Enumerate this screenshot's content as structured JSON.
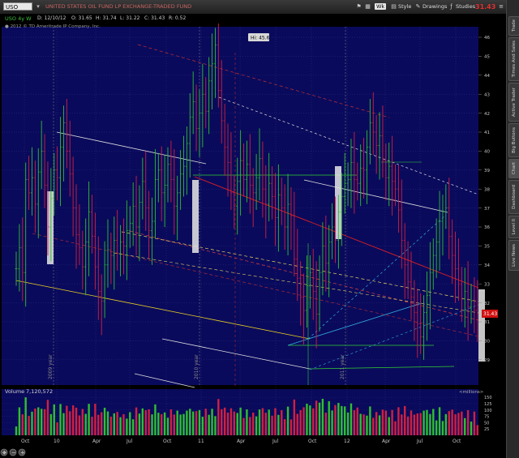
{
  "toolbar": {
    "symbol": "USO",
    "company": "UNITED STATES OIL FUND LP EXCHANGE-TRADED FUND",
    "aggregation": "Wk",
    "style_label": "Style",
    "drawings_label": "Drawings",
    "studies_label": "Studies",
    "last_price": "31.43"
  },
  "quote": {
    "label": "USO 4y W",
    "date": "D: 12/10/12",
    "open": "O: 31.65",
    "high": "H: 31.74",
    "low": "L: 31.22",
    "close": "C: 31.43",
    "change": "R: 0.52",
    "copyright": "2012 © TD Ameritrade IP Company, Inc."
  },
  "sidebar": {
    "tabs": [
      "Trade",
      "Times And Sales",
      "Active Trader",
      "Big Buttons",
      "Chart",
      "Dashboard",
      "Level II",
      "Live News"
    ]
  },
  "colors": {
    "background": "#0a0a5c",
    "grid": "#3a3a8a",
    "up": "#2fbf2f",
    "down": "#d02040",
    "price_tag": "#d01010"
  },
  "chart_data": {
    "type": "bar",
    "period": "weekly",
    "y_range": [
      28,
      47
    ],
    "y_ticks": [
      "46",
      "45",
      "44",
      "43",
      "42",
      "41",
      "40",
      "39",
      "38",
      "37",
      "36",
      "35",
      "34",
      "33",
      "32",
      "31",
      "30",
      "29"
    ],
    "hi_label": "Hi: 45.6",
    "x_labels": [
      "Oct",
      "10",
      "Apr",
      "Jul",
      "Oct",
      "11",
      "Apr",
      "Jul",
      "Oct",
      "12",
      "Apr",
      "Jul",
      "Oct"
    ],
    "year_labels": [
      "2009 year",
      "2010 year",
      "2011 year"
    ],
    "last_price": "31.43",
    "volume": {
      "label": "Volume",
      "value": "7,120,572",
      "unit": "<millions>",
      "ticks": [
        "150",
        "125",
        "100",
        "75",
        "50",
        "25"
      ],
      "y_range": [
        0,
        160
      ]
    },
    "price_series": [
      {
        "t": 0,
        "close": 33.8
      },
      {
        "t": 4,
        "close": 34.9
      },
      {
        "t": 8,
        "close": 33.6
      },
      {
        "t": 12,
        "close": 38.5
      },
      {
        "t": 16,
        "close": 37.8
      },
      {
        "t": 20,
        "close": 38.6
      },
      {
        "t": 24,
        "close": 37.2
      },
      {
        "t": 28,
        "close": 38.9
      },
      {
        "t": 32,
        "close": 40.0
      },
      {
        "t": 36,
        "close": 38.2
      },
      {
        "t": 40,
        "close": 36.0
      },
      {
        "t": 44,
        "close": 37.5
      },
      {
        "t": 48,
        "close": 39.0
      },
      {
        "t": 52,
        "close": 38.6
      },
      {
        "t": 56,
        "close": 40.2
      },
      {
        "t": 60,
        "close": 41.5
      },
      {
        "t": 64,
        "close": 40.0
      },
      {
        "t": 68,
        "close": 38.8
      },
      {
        "t": 72,
        "close": 37.0
      },
      {
        "t": 76,
        "close": 35.6
      },
      {
        "t": 80,
        "close": 34.9
      },
      {
        "t": 84,
        "close": 33.9
      },
      {
        "t": 88,
        "close": 35.2
      },
      {
        "t": 92,
        "close": 36.8
      },
      {
        "t": 96,
        "close": 35.5
      },
      {
        "t": 100,
        "close": 33.9
      },
      {
        "t": 104,
        "close": 32.6
      },
      {
        "t": 108,
        "close": 32.1
      },
      {
        "t": 112,
        "close": 34.0
      },
      {
        "t": 116,
        "close": 34.8
      },
      {
        "t": 120,
        "close": 34.5
      },
      {
        "t": 124,
        "close": 35.3
      },
      {
        "t": 128,
        "close": 34.6
      },
      {
        "t": 132,
        "close": 35.2
      },
      {
        "t": 136,
        "close": 35.0
      },
      {
        "t": 140,
        "close": 35.8
      },
      {
        "t": 144,
        "close": 36.2
      },
      {
        "t": 148,
        "close": 37.1
      },
      {
        "t": 152,
        "close": 36.0
      },
      {
        "t": 156,
        "close": 37.3
      },
      {
        "t": 160,
        "close": 38.4
      },
      {
        "t": 164,
        "close": 37.0
      },
      {
        "t": 168,
        "close": 35.8
      },
      {
        "t": 172,
        "close": 36.3
      },
      {
        "t": 176,
        "close": 38.5
      },
      {
        "t": 180,
        "close": 39.0
      },
      {
        "t": 184,
        "close": 37.8
      },
      {
        "t": 188,
        "close": 38.2
      },
      {
        "t": 192,
        "close": 39.3
      },
      {
        "t": 196,
        "close": 38.5
      },
      {
        "t": 200,
        "close": 37.1
      },
      {
        "t": 204,
        "close": 37.8
      },
      {
        "t": 208,
        "close": 38.8
      },
      {
        "t": 212,
        "close": 39.2
      },
      {
        "t": 216,
        "close": 40.4
      },
      {
        "t": 220,
        "close": 41.8
      },
      {
        "t": 224,
        "close": 42.6
      },
      {
        "t": 228,
        "close": 41.2
      },
      {
        "t": 232,
        "close": 42.0
      },
      {
        "t": 236,
        "close": 43.0
      },
      {
        "t": 240,
        "close": 42.1
      },
      {
        "t": 244,
        "close": 43.7
      },
      {
        "t": 248,
        "close": 44.6
      },
      {
        "t": 252,
        "close": 45.6
      },
      {
        "t": 256,
        "close": 43.2
      },
      {
        "t": 260,
        "close": 41.6
      },
      {
        "t": 264,
        "close": 40.2
      },
      {
        "t": 268,
        "close": 39.4
      },
      {
        "t": 272,
        "close": 37.8
      },
      {
        "t": 276,
        "close": 37.1
      },
      {
        "t": 280,
        "close": 38.4
      },
      {
        "t": 284,
        "close": 39.5
      },
      {
        "t": 288,
        "close": 38.5
      },
      {
        "t": 292,
        "close": 39.3
      },
      {
        "t": 296,
        "close": 38.2
      },
      {
        "t": 300,
        "close": 37.8
      },
      {
        "t": 304,
        "close": 38.6
      },
      {
        "t": 308,
        "close": 39.6
      },
      {
        "t": 312,
        "close": 38.0
      },
      {
        "t": 316,
        "close": 37.2
      },
      {
        "t": 320,
        "close": 38.3
      },
      {
        "t": 324,
        "close": 37.6
      },
      {
        "t": 328,
        "close": 36.5
      },
      {
        "t": 332,
        "close": 37.7
      },
      {
        "t": 336,
        "close": 37.0
      },
      {
        "t": 340,
        "close": 36.0
      },
      {
        "t": 344,
        "close": 37.2
      },
      {
        "t": 348,
        "close": 36.6
      },
      {
        "t": 352,
        "close": 34.3
      },
      {
        "t": 356,
        "close": 33.3
      },
      {
        "t": 360,
        "close": 32.3
      },
      {
        "t": 364,
        "close": 31.6
      },
      {
        "t": 368,
        "close": 32.9
      },
      {
        "t": 372,
        "close": 33.6
      },
      {
        "t": 376,
        "close": 32.6
      },
      {
        "t": 380,
        "close": 31.4
      },
      {
        "t": 384,
        "close": 33.6
      },
      {
        "t": 388,
        "close": 35.0
      },
      {
        "t": 392,
        "close": 34.1
      },
      {
        "t": 396,
        "close": 35.2
      },
      {
        "t": 400,
        "close": 36.0
      },
      {
        "t": 404,
        "close": 35.3
      },
      {
        "t": 408,
        "close": 36.8
      },
      {
        "t": 412,
        "close": 37.6
      },
      {
        "t": 416,
        "close": 38.3
      },
      {
        "t": 420,
        "close": 38.5
      },
      {
        "t": 424,
        "close": 39.4
      },
      {
        "t": 428,
        "close": 38.5
      },
      {
        "t": 432,
        "close": 38.3
      },
      {
        "t": 436,
        "close": 39.1
      },
      {
        "t": 440,
        "close": 39.0
      },
      {
        "t": 444,
        "close": 40.2
      },
      {
        "t": 448,
        "close": 41.5
      },
      {
        "t": 452,
        "close": 41.0
      },
      {
        "t": 456,
        "close": 40.3
      },
      {
        "t": 460,
        "close": 40.8
      },
      {
        "t": 464,
        "close": 39.5
      },
      {
        "t": 468,
        "close": 38.6
      },
      {
        "t": 472,
        "close": 39.2
      },
      {
        "t": 476,
        "close": 38.4
      },
      {
        "t": 480,
        "close": 38.0
      },
      {
        "t": 484,
        "close": 36.9
      },
      {
        "t": 488,
        "close": 35.3
      },
      {
        "t": 492,
        "close": 34.0
      },
      {
        "t": 496,
        "close": 33.1
      },
      {
        "t": 500,
        "close": 32.3
      },
      {
        "t": 504,
        "close": 31.5
      },
      {
        "t": 508,
        "close": 30.9
      },
      {
        "t": 512,
        "close": 30.2
      },
      {
        "t": 516,
        "close": 31.5
      },
      {
        "t": 520,
        "close": 32.4
      },
      {
        "t": 524,
        "close": 33.6
      },
      {
        "t": 528,
        "close": 34.5
      },
      {
        "t": 532,
        "close": 35.2
      },
      {
        "t": 536,
        "close": 36.3
      },
      {
        "t": 540,
        "close": 36.8
      },
      {
        "t": 544,
        "close": 37.0
      },
      {
        "t": 548,
        "close": 35.5
      },
      {
        "t": 552,
        "close": 34.5
      },
      {
        "t": 556,
        "close": 33.8
      },
      {
        "t": 560,
        "close": 33.0
      },
      {
        "t": 564,
        "close": 32.2
      },
      {
        "t": 568,
        "close": 32.6
      },
      {
        "t": 572,
        "close": 31.8
      },
      {
        "t": 576,
        "close": 32.1
      },
      {
        "t": 580,
        "close": 31.6
      },
      {
        "t": 584,
        "close": 31.43
      }
    ]
  }
}
